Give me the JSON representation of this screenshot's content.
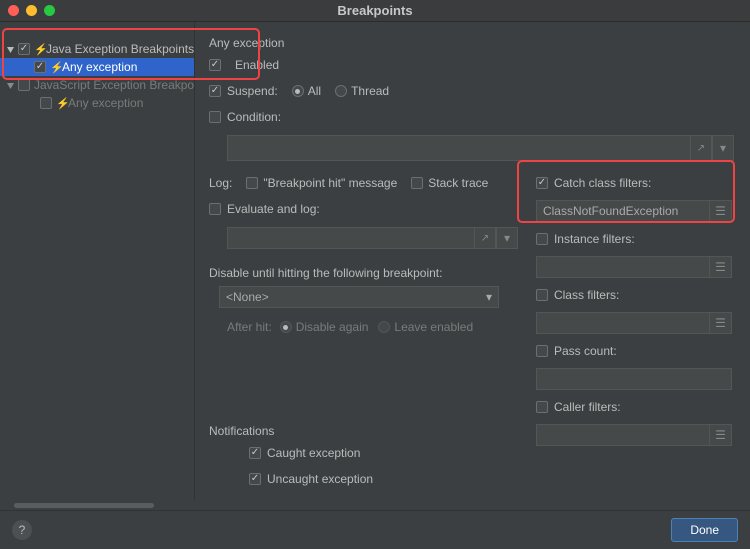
{
  "title": "Breakpoints",
  "tree": {
    "java_label": "Java Exception Breakpoints",
    "any_exception_label": "Any exception",
    "js_label": "JavaScript Exception Breakpoints",
    "any_exception_js": "Any exception"
  },
  "details": {
    "heading": "Any exception",
    "enabled": "Enabled",
    "suspend": "Suspend:",
    "all": "All",
    "thread": "Thread",
    "condition": "Condition:",
    "log": "Log:",
    "bp_hit": "\"Breakpoint hit\" message",
    "stack_trace": "Stack trace",
    "evaluate_log": "Evaluate and log:",
    "disable_until": "Disable until hitting the following breakpoint:",
    "none_option": "<None>",
    "after_hit": "After hit:",
    "disable_again": "Disable again",
    "leave_enabled": "Leave enabled",
    "catch_filters": "Catch class filters:",
    "catch_value": "ClassNotFoundException",
    "instance_filters": "Instance filters:",
    "class_filters": "Class filters:",
    "pass_count": "Pass count:",
    "caller_filters": "Caller filters:",
    "notifications": "Notifications",
    "caught": "Caught exception",
    "uncaught": "Uncaught exception"
  },
  "footer": {
    "done": "Done"
  }
}
